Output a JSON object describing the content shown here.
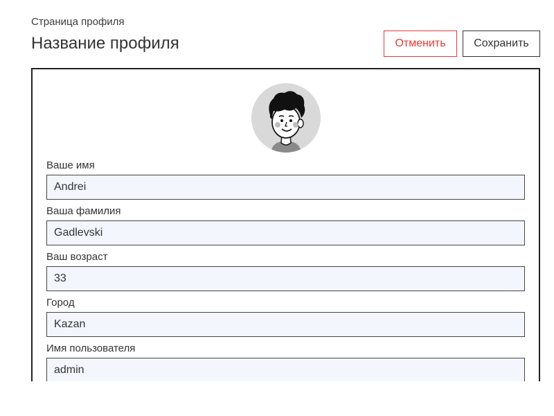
{
  "header": {
    "breadcrumb": "Страница профиля",
    "title": "Название профиля"
  },
  "actions": {
    "cancel_label": "Отменить",
    "save_label": "Сохранить"
  },
  "colors": {
    "cancel_accent": "#e53935",
    "input_background": "#f3f6fd",
    "border": "#222222"
  },
  "avatar": {
    "icon": "user-avatar-icon"
  },
  "form": {
    "fields": [
      {
        "label": "Ваше имя",
        "value": "Andrei"
      },
      {
        "label": "Ваша фамилия",
        "value": "Gadlevski"
      },
      {
        "label": "Ваш возраст",
        "value": "33"
      },
      {
        "label": "Город",
        "value": "Kazan"
      },
      {
        "label": "Имя пользователя",
        "value": "admin"
      }
    ]
  }
}
